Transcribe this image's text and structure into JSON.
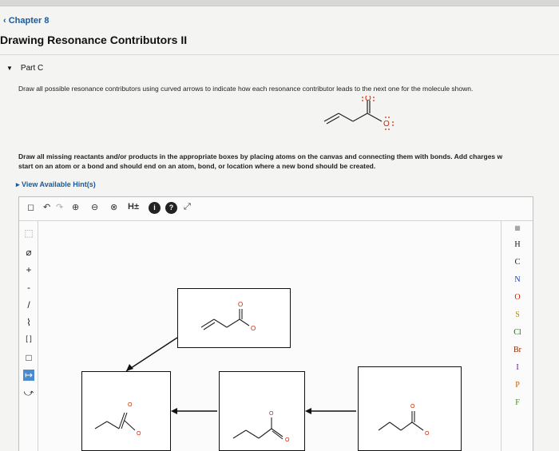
{
  "breadcrumb": {
    "back_label": "Chapter 8"
  },
  "page_title": "Drawing Resonance Contributors II",
  "part": {
    "label": "Part C"
  },
  "instructions": {
    "line1": "Draw all possible resonance contributors using curved arrows to indicate how each resonance contributor leads to the next one for the molecule shown.",
    "line2a": "Draw all missing reactants and/or products in the appropriate boxes by placing atoms on the canvas and connecting them with bonds. Add charges w",
    "line2b": "start on an atom or a bond and should end on an atom, bond, or location where a new bond should be created."
  },
  "hint": {
    "label": "View Available Hint(s)"
  },
  "toolbar": {
    "items": [
      {
        "name": "new-icon",
        "glyph": "◻"
      },
      {
        "name": "undo-icon",
        "glyph": "↶"
      },
      {
        "name": "redo-icon",
        "glyph": "↷"
      },
      {
        "name": "zoom-in-icon",
        "glyph": "⊕"
      },
      {
        "name": "zoom-out-icon",
        "glyph": "⊖"
      },
      {
        "name": "zoom-reset-icon",
        "glyph": "⊗"
      },
      {
        "name": "h-toggle",
        "glyph": "H±"
      },
      {
        "name": "info-icon",
        "glyph": "i"
      },
      {
        "name": "help-icon",
        "glyph": "?"
      },
      {
        "name": "expand-icon",
        "glyph": "⤢"
      }
    ]
  },
  "left_tools": [
    {
      "name": "select-tool",
      "glyph": "⬚"
    },
    {
      "name": "eraser-tool",
      "glyph": "⌀"
    },
    {
      "name": "positive-charge-tool",
      "glyph": "+"
    },
    {
      "name": "negative-charge-tool",
      "glyph": "-"
    },
    {
      "name": "bond-tool",
      "glyph": "/"
    },
    {
      "name": "chain-tool",
      "glyph": "⌇"
    },
    {
      "name": "bracket-tool",
      "glyph": "[ ]"
    },
    {
      "name": "box-tool",
      "glyph": "□"
    },
    {
      "name": "arrow-tool",
      "glyph": "↦"
    },
    {
      "name": "curved-arrow-tool",
      "glyph": "⤻"
    }
  ],
  "elements": [
    "H",
    "C",
    "N",
    "O",
    "S",
    "Cl",
    "Br",
    "I",
    "P",
    "F"
  ],
  "colors": {
    "link": "#1a5a9a",
    "oxygen": "#cc2200",
    "nitrogen": "#1a3fb0",
    "sulfur": "#b08a00",
    "halogen": "#226622"
  },
  "structures": {
    "target_o_top": "O",
    "target_o_right": "O",
    "box_o_top": "O",
    "box_o_right": "O"
  }
}
